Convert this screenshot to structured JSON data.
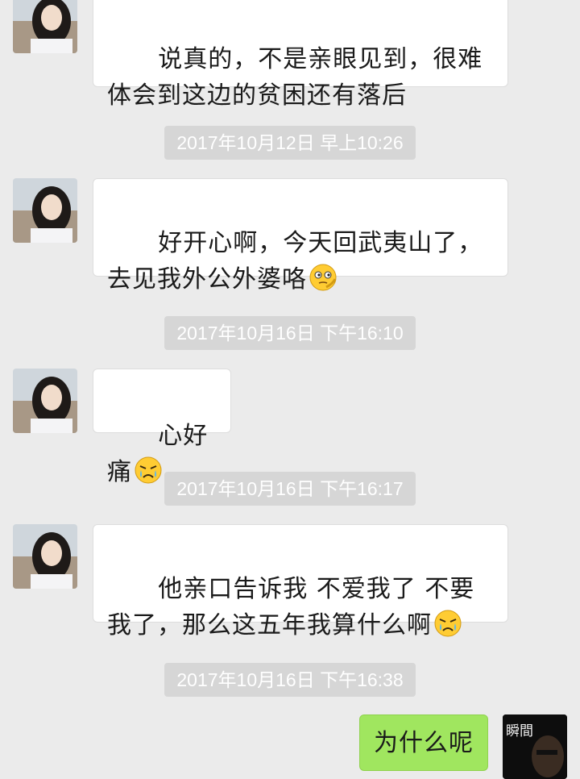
{
  "messages": [
    {
      "kind": "received",
      "text": "说真的，不是亲眼见到，很难体会到这边的贫困还有落后"
    },
    {
      "kind": "timestamp",
      "text": "2017年10月12日 早上10:26"
    },
    {
      "kind": "received",
      "text": "好开心啊，今天回武夷山了，去见我外公外婆咯",
      "emoji": "thinking-face-emoji"
    },
    {
      "kind": "timestamp",
      "text": "2017年10月16日 下午16:10"
    },
    {
      "kind": "received",
      "text": "心好痛",
      "emoji": "crying-face-emoji"
    },
    {
      "kind": "timestamp",
      "text": "2017年10月16日 下午16:17"
    },
    {
      "kind": "received",
      "text": "他亲口告诉我 不爱我了 不要我了，那么这五年我算什么啊",
      "emoji": "crying-face-emoji"
    },
    {
      "kind": "timestamp",
      "text": "2017年10月16日 下午16:38"
    },
    {
      "kind": "sent",
      "text": "为什么呢"
    }
  ],
  "colors": {
    "background": "#ebebeb",
    "received_bubble": "#ffffff",
    "sent_bubble": "#a0e65f",
    "timestamp_pill": "#d6d6d6",
    "timestamp_text": "#ffffff"
  },
  "contact_avatar": "girl-profile-photo",
  "self_avatar": {
    "icon": "dark-portrait-avatar",
    "overlay_text": "瞬間"
  }
}
